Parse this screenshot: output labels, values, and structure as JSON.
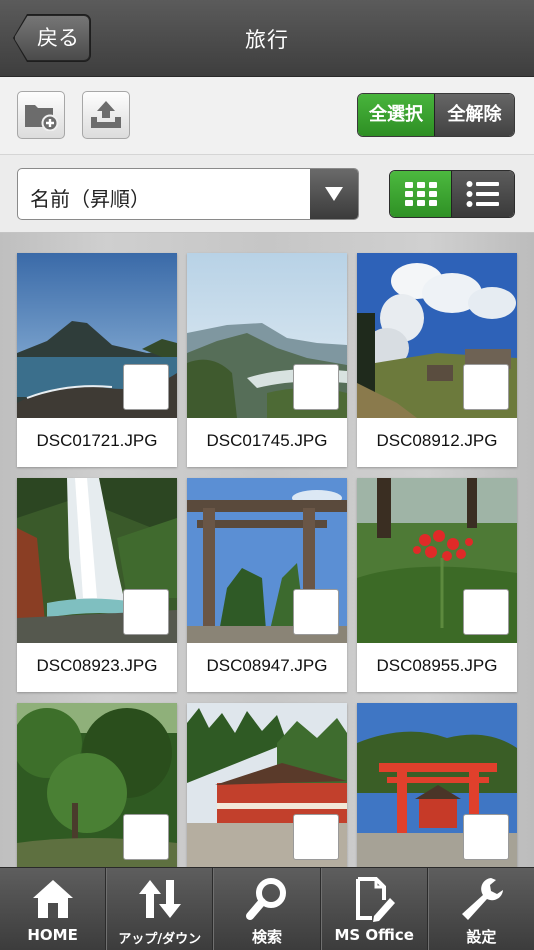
{
  "navbar": {
    "back_label": "戻る",
    "title": "旅行"
  },
  "toolbar": {
    "new_folder_icon": "folder-add-icon",
    "upload_icon": "upload-tray-icon",
    "select_all_label": "全選択",
    "deselect_all_label": "全解除"
  },
  "sort": {
    "selected": "名前（昇順）",
    "view_mode": "grid"
  },
  "files": [
    {
      "name": "DSC01721.JPG",
      "selected": false
    },
    {
      "name": "DSC01745.JPG",
      "selected": false
    },
    {
      "name": "DSC08912.JPG",
      "selected": false
    },
    {
      "name": "DSC08923.JPG",
      "selected": false
    },
    {
      "name": "DSC08947.JPG",
      "selected": false
    },
    {
      "name": "DSC08955.JPG",
      "selected": false
    },
    {
      "name": "",
      "selected": false
    },
    {
      "name": "",
      "selected": false
    },
    {
      "name": "",
      "selected": false
    }
  ],
  "tabs": [
    {
      "label": "HOME",
      "icon": "home-icon"
    },
    {
      "label": "アップ/ダウン",
      "icon": "up-down-arrows-icon"
    },
    {
      "label": "検索",
      "icon": "search-icon"
    },
    {
      "label": "MS Office",
      "icon": "document-edit-icon"
    },
    {
      "label": "設定",
      "icon": "wrench-icon"
    }
  ],
  "colors": {
    "accent_green": "#3aa22f",
    "bar_dark": "#4a4a4a"
  }
}
